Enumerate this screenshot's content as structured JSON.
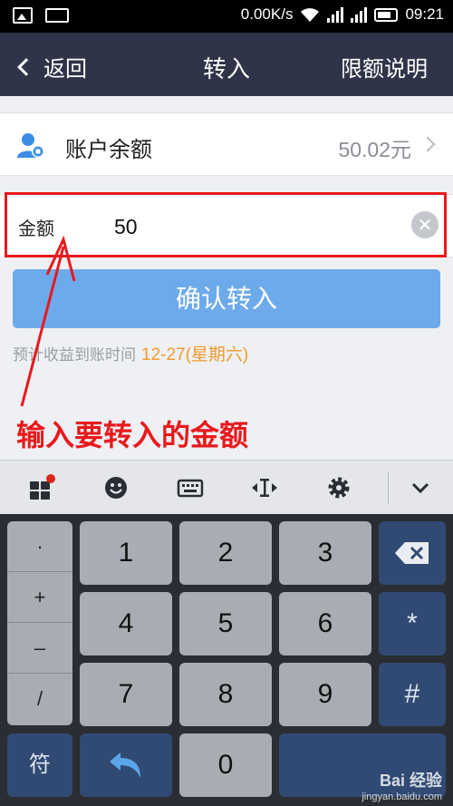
{
  "status_bar": {
    "speed": "0.00K/s",
    "time": "09:21"
  },
  "nav": {
    "back_label": "返回",
    "title": "转入",
    "right_label": "限额说明"
  },
  "balance": {
    "label": "账户余额",
    "value": "50.02元"
  },
  "amount": {
    "label": "金额",
    "value": "50"
  },
  "confirm_button": "确认转入",
  "tip": {
    "text": "预计收益到账时间",
    "date": "12-27(星期六)"
  },
  "annotation": "输入要转入的金额",
  "keyboard": {
    "symbols": [
      "·",
      "+",
      "–",
      "/"
    ],
    "keys": [
      "1",
      "2",
      "3",
      "4",
      "5",
      "6",
      "7",
      "8",
      "9",
      "0"
    ],
    "star": "*",
    "hash": "#",
    "fu": "符"
  },
  "watermark": {
    "brand": "Bai 经验",
    "url": "jingyan.baidu.com"
  },
  "colors": {
    "nav_bg": "#2f3448",
    "confirm_bg": "#6daaeb",
    "accent_orange": "#f29b2e",
    "annotation_red": "#e8191c"
  }
}
